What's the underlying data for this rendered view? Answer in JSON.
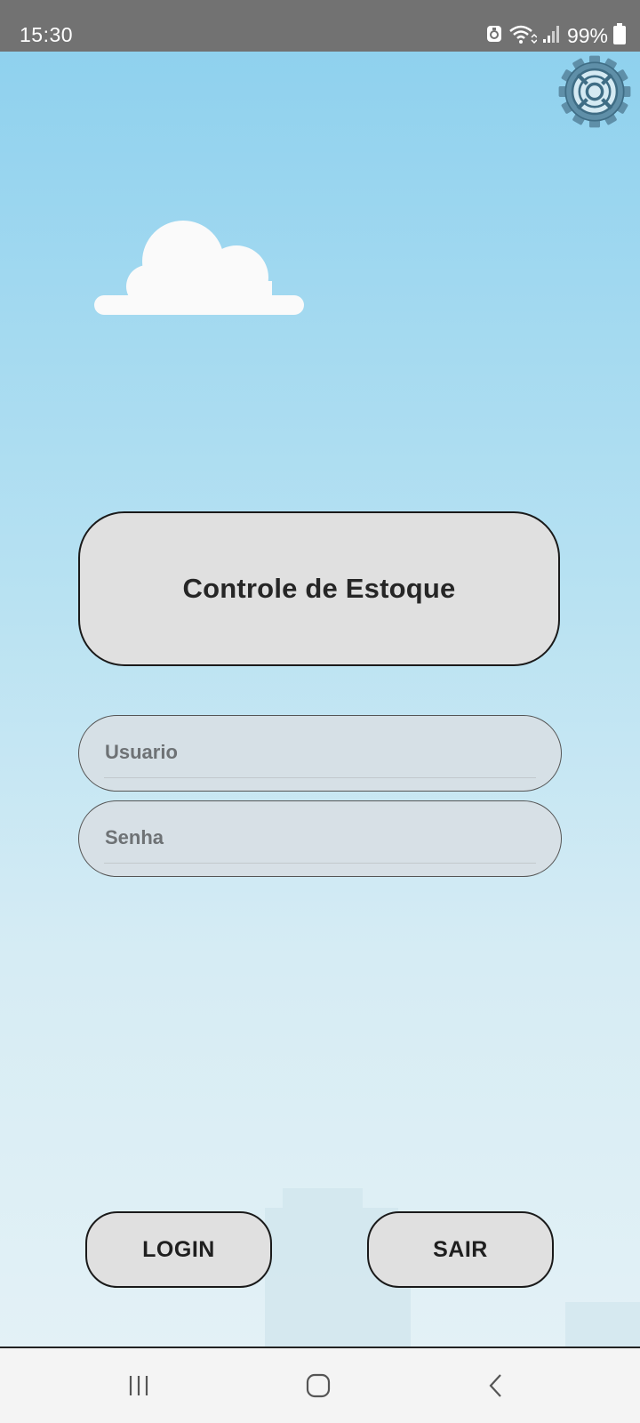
{
  "status_bar": {
    "time": "15:30",
    "battery_percent": "99%",
    "icons": [
      "notification-app-icon",
      "wifi-icon",
      "signal-icon",
      "battery-icon"
    ]
  },
  "app": {
    "title": "Controle de Estoque",
    "username": {
      "placeholder": "Usuario",
      "value": ""
    },
    "password": {
      "placeholder": "Senha",
      "value": ""
    },
    "login_label": "LOGIN",
    "exit_label": "SAIR",
    "settings_icon": "gear-icon"
  },
  "nav_bar": {
    "icons": [
      "recent-apps-icon",
      "home-icon",
      "back-icon"
    ]
  },
  "colors": {
    "sky_top": "#8fd1ee",
    "sky_bottom": "#e3f1f6",
    "button_fill": "#e0e0e0",
    "gear": "#5f8fa8"
  }
}
